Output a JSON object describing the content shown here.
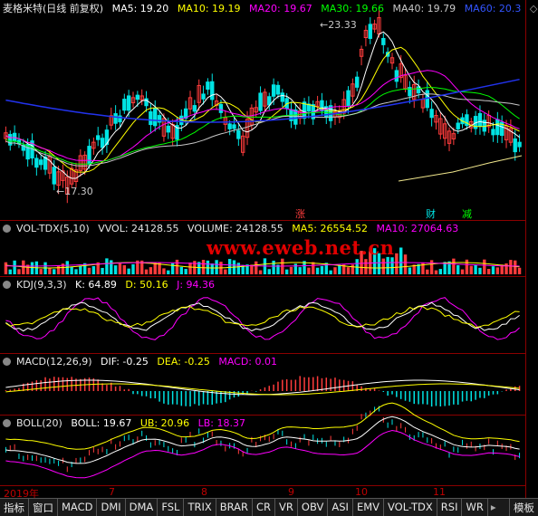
{
  "header": {
    "title": "麦格米特(日线 前复权)",
    "ma5": "MA5: 19.20",
    "ma10": "MA10: 19.19",
    "ma20": "MA20: 19.67",
    "ma30": "MA30: 19.66",
    "ma40": "MA40: 19.79",
    "ma60": "MA60: 20.3",
    "controls": "◇"
  },
  "price_panel": {
    "high_label": "23.33",
    "low_label": "17.30",
    "markers": [
      "涨",
      "财",
      "减"
    ]
  },
  "vol_panel": {
    "name": "VOL-TDX(5,10)",
    "vvol": "VVOL: 24128.55",
    "volume": "VOLUME: 24128.55",
    "ma5": "MA5: 26554.52",
    "ma10": "MA10: 27064.63"
  },
  "watermark": "www.eweb.net.cn",
  "kdj_panel": {
    "name": "KDJ(9,3,3)",
    "k": "K: 64.89",
    "d": "D: 50.16",
    "j": "J: 94.36"
  },
  "macd_panel": {
    "name": "MACD(12,26,9)",
    "dif": "DIF: -0.25",
    "dea": "DEA: -0.25",
    "macd": "MACD: 0.01"
  },
  "boll_panel": {
    "name": "BOLL(20)",
    "boll": "BOLL: 19.67",
    "ub": "UB: 20.96",
    "lb": "LB: 18.37"
  },
  "time_axis": [
    "2019年",
    "7",
    "8",
    "9",
    "10",
    "11"
  ],
  "tabs": [
    "指标",
    "窗口",
    "MACD",
    "DMI",
    "DMA",
    "FSL",
    "TRIX",
    "BRAR",
    "CR",
    "VR",
    "OBV",
    "ASI",
    "EMV",
    "VOL-TDX",
    "RSI",
    "WR"
  ],
  "tab_right": "模板",
  "colors": {
    "up": "#ff3c3c",
    "down": "#00e4e4",
    "ma5": "#ffffff",
    "ma10": "#ffff00",
    "ma20": "#ff00ff",
    "ma30": "#00ff00",
    "ma60": "#0000ff",
    "border": "#8b0000"
  }
}
